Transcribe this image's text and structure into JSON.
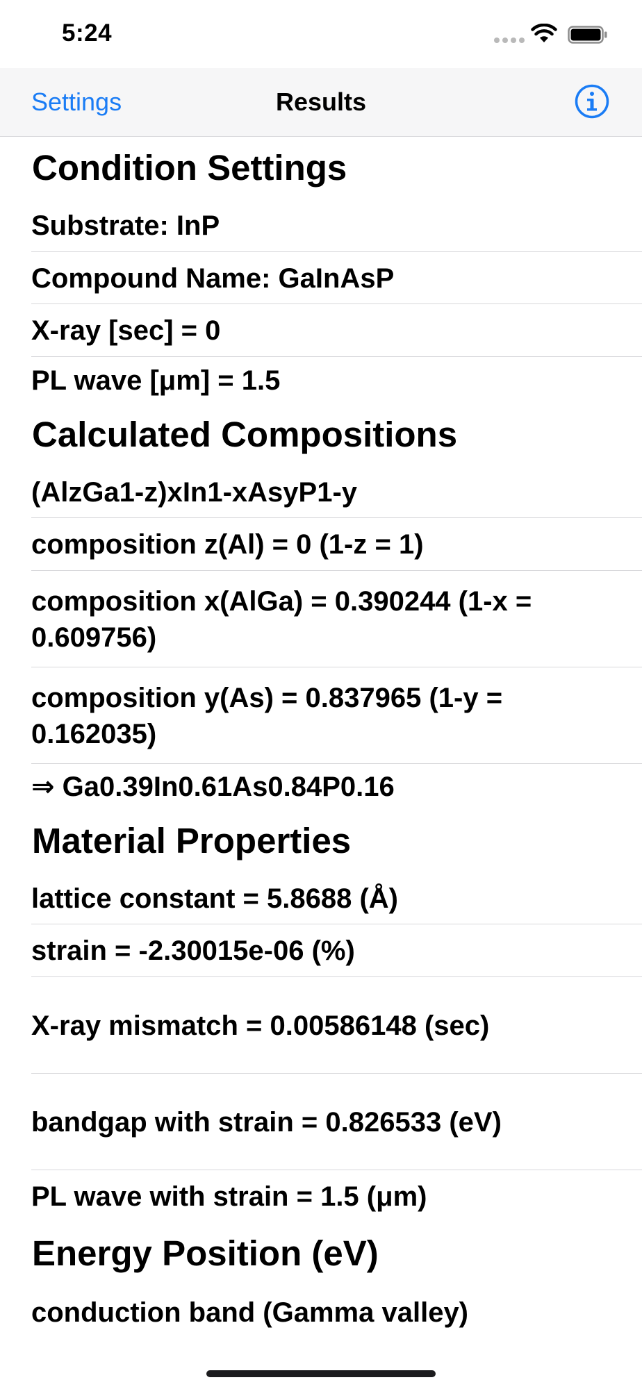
{
  "status_bar": {
    "time": "5:24"
  },
  "nav": {
    "back_label": "Settings",
    "title": "Results",
    "info_icon": "info-circle-icon",
    "accent_color": "#1a7cf5"
  },
  "sections": {
    "condition": {
      "title": "Condition Settings",
      "substrate": "Substrate: InP",
      "compound": "Compound Name: GaInAsP",
      "xray": "X-ray [sec] = 0",
      "pl_wave": "PL wave [μm] = 1.5"
    },
    "compositions": {
      "title": "Calculated Compositions",
      "formula": "(AlzGa1-z)xIn1-xAsyP1-y",
      "comp_z": "composition z(Al) = 0 (1-z = 1)",
      "comp_x": "composition x(AlGa) = 0.390244 (1-x = 0.609756)",
      "comp_y": "composition y(As) = 0.837965 (1-y = 0.162035)",
      "result": "⇒ Ga0.39In0.61As0.84P0.16"
    },
    "material": {
      "title": "Material Properties",
      "lattice": "lattice constant = 5.8688 (Å)",
      "strain": "strain = -2.30015e-06 (%)",
      "xray_mismatch": "X-ray mismatch = 0.00586148 (sec)",
      "bandgap": "bandgap with strain = 0.826533 (eV)",
      "pl_wave_strain": "PL wave with strain = 1.5 (μm)"
    },
    "energy": {
      "title": "Energy Position (eV)",
      "conduction": "conduction band (Gamma valley)"
    }
  }
}
